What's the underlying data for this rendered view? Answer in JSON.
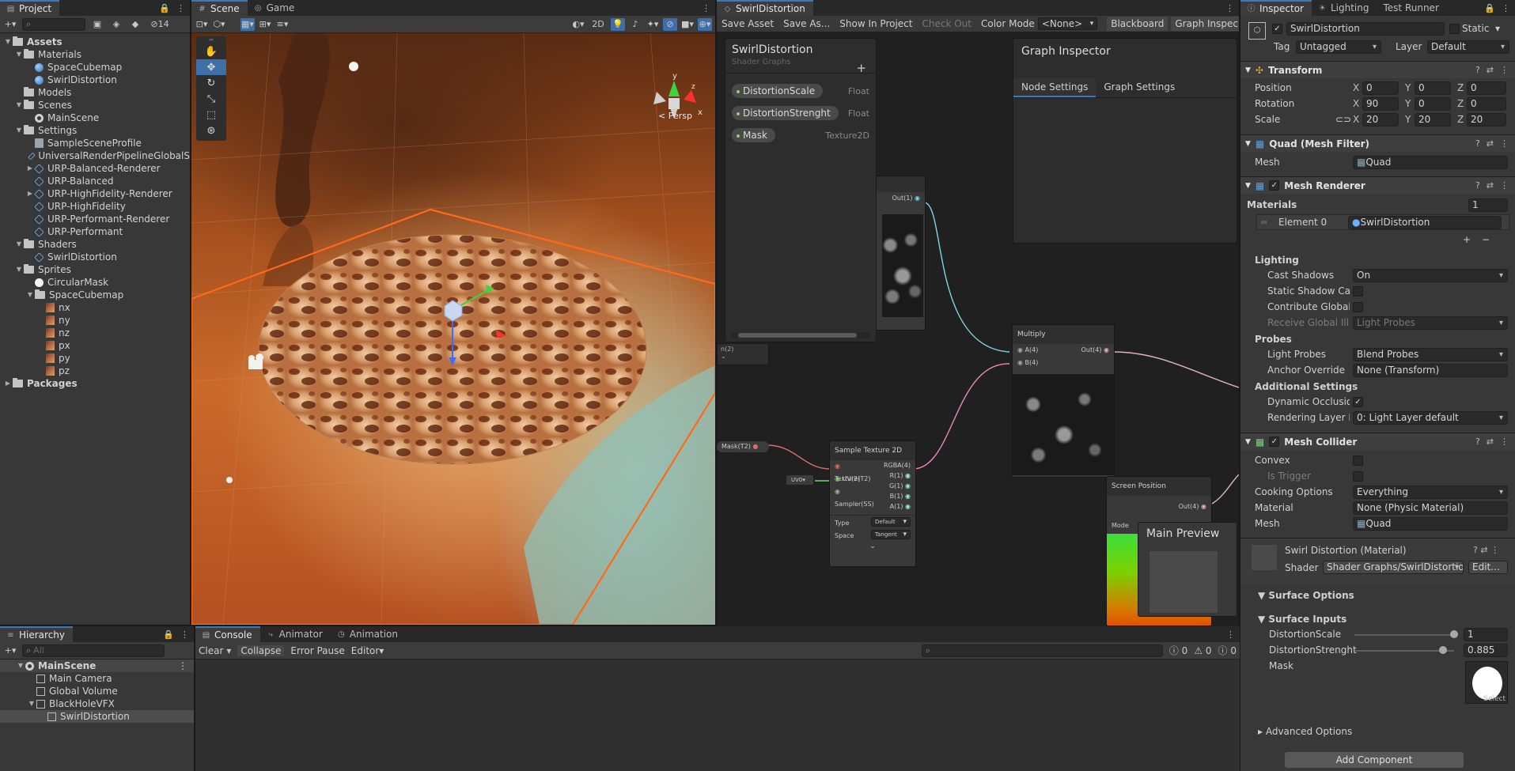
{
  "project": {
    "tab": "Project",
    "hidden_count": "14",
    "search_placeholder": "",
    "tree": [
      {
        "label": "Assets",
        "depth": 0,
        "kind": "folder",
        "open": true,
        "bold": true
      },
      {
        "label": "Materials",
        "depth": 1,
        "kind": "folder",
        "open": true
      },
      {
        "label": "SpaceCubemap",
        "depth": 2,
        "kind": "material"
      },
      {
        "label": "SwirlDistortion",
        "depth": 2,
        "kind": "material"
      },
      {
        "label": "Models",
        "depth": 1,
        "kind": "folder"
      },
      {
        "label": "Scenes",
        "depth": 1,
        "kind": "folder",
        "open": true
      },
      {
        "label": "MainScene",
        "depth": 2,
        "kind": "scene"
      },
      {
        "label": "Settings",
        "depth": 1,
        "kind": "folder",
        "open": true
      },
      {
        "label": "SampleSceneProfile",
        "depth": 2,
        "kind": "file"
      },
      {
        "label": "UniversalRenderPipelineGlobalS",
        "depth": 2,
        "kind": "shader"
      },
      {
        "label": "URP-Balanced-Renderer",
        "depth": 2,
        "kind": "shader",
        "arrow": true
      },
      {
        "label": "URP-Balanced",
        "depth": 2,
        "kind": "shader"
      },
      {
        "label": "URP-HighFidelity-Renderer",
        "depth": 2,
        "kind": "shader",
        "arrow": true
      },
      {
        "label": "URP-HighFidelity",
        "depth": 2,
        "kind": "shader"
      },
      {
        "label": "URP-Performant-Renderer",
        "depth": 2,
        "kind": "shader"
      },
      {
        "label": "URP-Performant",
        "depth": 2,
        "kind": "shader"
      },
      {
        "label": "Shaders",
        "depth": 1,
        "kind": "folder",
        "open": true
      },
      {
        "label": "SwirlDistortion",
        "depth": 2,
        "kind": "shader"
      },
      {
        "label": "Sprites",
        "depth": 1,
        "kind": "folder",
        "open": true
      },
      {
        "label": "CircularMask",
        "depth": 2,
        "kind": "circle"
      },
      {
        "label": "SpaceCubemap",
        "depth": 2,
        "kind": "folder",
        "open": true
      },
      {
        "label": "nx",
        "depth": 3,
        "kind": "sprite"
      },
      {
        "label": "ny",
        "depth": 3,
        "kind": "sprite"
      },
      {
        "label": "nz",
        "depth": 3,
        "kind": "sprite"
      },
      {
        "label": "px",
        "depth": 3,
        "kind": "sprite"
      },
      {
        "label": "py",
        "depth": 3,
        "kind": "sprite"
      },
      {
        "label": "pz",
        "depth": 3,
        "kind": "sprite"
      },
      {
        "label": "Packages",
        "depth": 0,
        "kind": "folder",
        "bold": true
      }
    ]
  },
  "scene": {
    "tabs": [
      "Scene",
      "Game"
    ],
    "mode_2d": "2D",
    "persp_label": "< Persp",
    "gizmo_axes": {
      "x": "x",
      "y": "y",
      "z": "z"
    }
  },
  "graph": {
    "tab": "SwirlDistortion",
    "toolbar": {
      "save_asset": "Save Asset",
      "save_as": "Save As...",
      "show_in_project": "Show In Project",
      "check_out": "Check Out",
      "color_mode_label": "Color Mode",
      "color_mode_value": "<None>",
      "blackboard": "Blackboard",
      "graph_inspector": "Graph Inspec"
    },
    "blackboard": {
      "title": "SwirlDistortion",
      "subtitle": "Shader Graphs",
      "properties": [
        {
          "name": "DistortionScale",
          "type": "Float"
        },
        {
          "name": "DistortionStrenght",
          "type": "Float"
        },
        {
          "name": "Mask",
          "type": "Texture2D"
        }
      ]
    },
    "inspector": {
      "title": "Graph Inspector",
      "tabs": [
        "Node Settings",
        "Graph Settings"
      ]
    },
    "nodes": {
      "out_top": "Out(1)",
      "multiply": {
        "title": "Multiply",
        "a": "A(4)",
        "b": "B(4)",
        "out": "Out(4)"
      },
      "mask_prop": "Mask(T2)",
      "uv_prop": "UV0",
      "sample": {
        "title": "Sample Texture 2D",
        "inputs": [
          "Texture(T2)",
          "UV(2)",
          "Sampler(SS)"
        ],
        "outputs": [
          "RGBA(4)",
          "R(1)",
          "G(1)",
          "B(1)",
          "A(1)"
        ],
        "type_label": "Type",
        "type_value": "Default",
        "space_label": "Space",
        "space_value": "Tangent"
      },
      "screen_pos": {
        "title": "Screen Position",
        "out": "Out(4)",
        "mode": "Mode"
      },
      "stub_label": "n(2)"
    },
    "main_preview": "Main Preview"
  },
  "inspector": {
    "tabs": [
      "Inspector",
      "Lighting",
      "Test Runner"
    ],
    "object_name": "SwirlDistortion",
    "static_label": "Static",
    "tag_label": "Tag",
    "tag_value": "Untagged",
    "layer_label": "Layer",
    "layer_value": "Default",
    "transform": {
      "title": "Transform",
      "position": {
        "label": "Position",
        "x": "0",
        "y": "0",
        "z": "0"
      },
      "rotation": {
        "label": "Rotation",
        "x": "90",
        "y": "0",
        "z": "0"
      },
      "scale": {
        "label": "Scale",
        "x": "20",
        "y": "20",
        "z": "20"
      }
    },
    "mesh_filter": {
      "title": "Quad (Mesh Filter)",
      "mesh_label": "Mesh",
      "mesh_value": "Quad"
    },
    "mesh_renderer": {
      "title": "Mesh Renderer",
      "materials_label": "Materials",
      "materials_count": "1",
      "element_label": "Element 0",
      "element_value": "SwirlDistortion",
      "lighting_label": "Lighting",
      "cast_shadows_label": "Cast Shadows",
      "cast_shadows_value": "On",
      "static_shadow_label": "Static Shadow Cas",
      "contribute_gi_label": "Contribute Global I",
      "receive_gi_label": "Receive Global Illu",
      "receive_gi_value": "Light Probes",
      "probes_label": "Probes",
      "light_probes_label": "Light Probes",
      "light_probes_value": "Blend Probes",
      "anchor_label": "Anchor Override",
      "anchor_value": "None (Transform)",
      "additional_label": "Additional Settings",
      "dynamic_occ_label": "Dynamic Occlusio",
      "rendering_layer_label": "Rendering Layer M",
      "rendering_layer_value": "0: Light Layer default"
    },
    "mesh_collider": {
      "title": "Mesh Collider",
      "convex_label": "Convex",
      "trigger_label": "Is Trigger",
      "cooking_label": "Cooking Options",
      "cooking_value": "Everything",
      "material_label": "Material",
      "material_value": "None (Physic Material)",
      "mesh_label": "Mesh",
      "mesh_value": "Quad"
    },
    "material": {
      "title": "Swirl Distortion (Material)",
      "shader_label": "Shader",
      "shader_value": "Shader Graphs/SwirlDistortio",
      "edit_label": "Edit...",
      "surface_options": "Surface Options",
      "surface_inputs": "Surface Inputs",
      "distortion_scale_label": "DistortionScale",
      "distortion_scale_value": "1",
      "distortion_scale_fraction": 1.0,
      "distortion_strength_label": "DistortionStrenght",
      "distortion_strength_value": "0.885",
      "distortion_strength_fraction": 0.885,
      "mask_label": "Mask",
      "select_label": "Select",
      "advanced": "Advanced Options"
    },
    "add_component": "Add Component"
  },
  "hierarchy": {
    "tab": "Hierarchy",
    "search_placeholder": "All",
    "items": [
      {
        "label": "MainScene",
        "depth": 0,
        "bold": true
      },
      {
        "label": "Main Camera",
        "depth": 1
      },
      {
        "label": "Global Volume",
        "depth": 1
      },
      {
        "label": "BlackHoleVFX",
        "depth": 1
      },
      {
        "label": "SwirlDistortion",
        "depth": 2,
        "selected": true
      }
    ]
  },
  "console": {
    "tabs": [
      "Console",
      "Animator",
      "Animation"
    ],
    "clear": "Clear",
    "collapse": "Collapse",
    "error_pause": "Error Pause",
    "editor": "Editor",
    "counts": {
      "log": "0",
      "warn": "0",
      "error": "0"
    }
  }
}
